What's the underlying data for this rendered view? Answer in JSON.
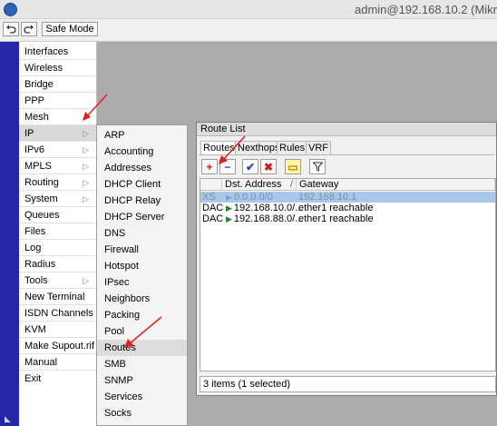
{
  "titlebar": {
    "title": "admin@192.168.10.2 (Mikr"
  },
  "toolbar": {
    "undo_icon": "undo-icon",
    "redo_icon": "redo-icon",
    "safe_mode": "Safe Mode"
  },
  "menu": {
    "items": [
      {
        "label": "Interfaces",
        "arrow": ""
      },
      {
        "label": "Wireless",
        "arrow": ""
      },
      {
        "label": "Bridge",
        "arrow": ""
      },
      {
        "label": "PPP",
        "arrow": ""
      },
      {
        "label": "Mesh",
        "arrow": ""
      },
      {
        "label": "IP",
        "arrow": "▷"
      },
      {
        "label": "IPv6",
        "arrow": "▷"
      },
      {
        "label": "MPLS",
        "arrow": "▷"
      },
      {
        "label": "Routing",
        "arrow": "▷"
      },
      {
        "label": "System",
        "arrow": "▷"
      },
      {
        "label": "Queues",
        "arrow": ""
      },
      {
        "label": "Files",
        "arrow": ""
      },
      {
        "label": "Log",
        "arrow": ""
      },
      {
        "label": "Radius",
        "arrow": ""
      },
      {
        "label": "Tools",
        "arrow": "▷"
      },
      {
        "label": "New Terminal",
        "arrow": ""
      },
      {
        "label": "ISDN Channels",
        "arrow": ""
      },
      {
        "label": "KVM",
        "arrow": ""
      },
      {
        "label": "Make Supout.rif",
        "arrow": ""
      },
      {
        "label": "Manual",
        "arrow": ""
      },
      {
        "label": "Exit",
        "arrow": ""
      }
    ]
  },
  "submenu": {
    "items": [
      {
        "label": "ARP"
      },
      {
        "label": "Accounting"
      },
      {
        "label": "Addresses"
      },
      {
        "label": "DHCP Client"
      },
      {
        "label": "DHCP Relay"
      },
      {
        "label": "DHCP Server"
      },
      {
        "label": "DNS"
      },
      {
        "label": "Firewall"
      },
      {
        "label": "Hotspot"
      },
      {
        "label": "IPsec"
      },
      {
        "label": "Neighbors"
      },
      {
        "label": "Packing"
      },
      {
        "label": "Pool"
      },
      {
        "label": "Routes"
      },
      {
        "label": "SMB"
      },
      {
        "label": "SNMP"
      },
      {
        "label": "Services"
      },
      {
        "label": "Socks"
      }
    ]
  },
  "route_window": {
    "title": "Route List",
    "tabs": [
      {
        "label": "Routes"
      },
      {
        "label": "Nexthops"
      },
      {
        "label": "Rules"
      },
      {
        "label": "VRF"
      }
    ],
    "buttons": {
      "add": "+",
      "remove": "−",
      "enable": "✔",
      "disable": "✖",
      "comment": "▭",
      "filter": "Y"
    },
    "columns": {
      "flags": "",
      "dst": "Dst. Address",
      "sort": "/",
      "gateway": "Gateway"
    },
    "rows": [
      {
        "flags": "XS",
        "dst": "0.0.0.0/0",
        "gateway": "192.168.10.1"
      },
      {
        "flags": "DAC",
        "dst": "192.168.10.0/...",
        "gateway": "ether1 reachable"
      },
      {
        "flags": "DAC",
        "dst": "192.168.88.0/...",
        "gateway": "ether1 reachable"
      }
    ],
    "status": "3 items (1 selected)"
  },
  "colors": {
    "accent_bar": "#2427a8",
    "selected_row": "#a9c7ec",
    "add_button": "#d11a1a"
  }
}
